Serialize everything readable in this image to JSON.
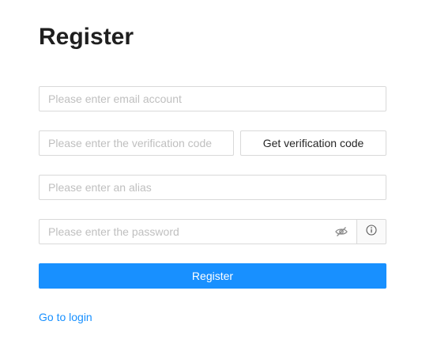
{
  "page": {
    "title": "Register"
  },
  "form": {
    "email_placeholder": "Please enter email account",
    "email_value": "",
    "code_placeholder": "Please enter the verification code",
    "code_value": "",
    "get_code_label": "Get verification code",
    "alias_placeholder": "Please enter an alias",
    "alias_value": "",
    "password_placeholder": "Please enter the password",
    "password_value": "",
    "password_visibility_icon": "eye-invisible-icon",
    "password_info_icon": "info-circle-icon",
    "register_label": "Register"
  },
  "footer": {
    "login_link_label": "Go to login"
  },
  "colors": {
    "primary": "#1890ff",
    "border": "#d9d9d9",
    "placeholder": "#bfbfbf",
    "title": "#1f1f1f"
  }
}
